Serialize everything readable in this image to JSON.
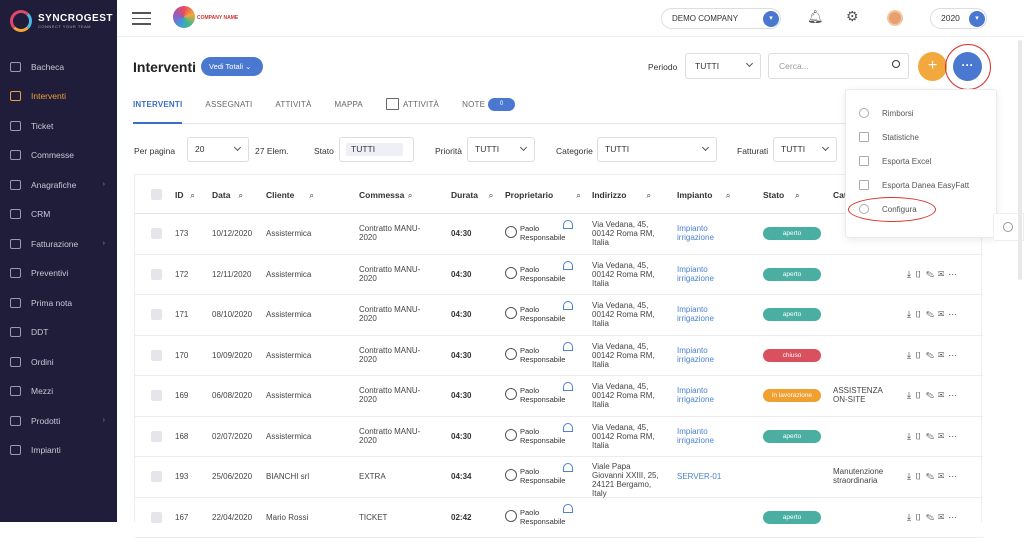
{
  "app": {
    "name": "SYNCROGEST",
    "tagline": "CONNECT YOUR TEAM"
  },
  "sidebar": {
    "items": [
      {
        "label": "Bacheca",
        "icon": "speedometer-icon",
        "active": false,
        "chevron": false
      },
      {
        "label": "Interventi",
        "icon": "tools-icon",
        "active": true,
        "chevron": false
      },
      {
        "label": "Ticket",
        "icon": "ticket-icon",
        "active": false,
        "chevron": false
      },
      {
        "label": "Commesse",
        "icon": "folder-icon",
        "active": false,
        "chevron": false
      },
      {
        "label": "Anagrafiche",
        "icon": "contacts-icon",
        "active": false,
        "chevron": true
      },
      {
        "label": "CRM",
        "icon": "handshake-icon",
        "active": false,
        "chevron": false
      },
      {
        "label": "Fatturazione",
        "icon": "invoice-icon",
        "active": false,
        "chevron": true
      },
      {
        "label": "Preventivi",
        "icon": "quote-icon",
        "active": false,
        "chevron": false
      },
      {
        "label": "Prima nota",
        "icon": "notebook-icon",
        "active": false,
        "chevron": false
      },
      {
        "label": "DDT",
        "icon": "document-icon",
        "active": false,
        "chevron": false
      },
      {
        "label": "Ordini",
        "icon": "cart-icon",
        "active": false,
        "chevron": false
      },
      {
        "label": "Mezzi",
        "icon": "truck-icon",
        "active": false,
        "chevron": false
      },
      {
        "label": "Prodotti",
        "icon": "box-icon",
        "active": false,
        "chevron": true
      },
      {
        "label": "Impianti",
        "icon": "flag-icon",
        "active": false,
        "chevron": false
      }
    ]
  },
  "topbar": {
    "company_logo_text": "COMPANY NAME",
    "company_select": "DEMO COMPANY",
    "year_select": "2020"
  },
  "header": {
    "title": "Interventi",
    "vedi_totali": "Vedi Totali",
    "periodo_label": "Periodo",
    "periodo_value": "TUTTI",
    "search_placeholder": "Cerca...",
    "add_symbol": "+",
    "more_symbol": "···"
  },
  "tabs": [
    {
      "label": "INTERVENTI",
      "active": true
    },
    {
      "label": "ASSEGNATI",
      "active": false
    },
    {
      "label": "ATTIVITÀ",
      "active": false
    },
    {
      "label": "MAPPA",
      "active": false
    },
    {
      "label": "ATTIVITÀ",
      "active": false,
      "calendar": true
    },
    {
      "label": "NOTE",
      "active": false,
      "count": "0"
    }
  ],
  "filters": {
    "per_pagina_label": "Per pagina",
    "per_pagina_value": "20",
    "elem_count": "27 Elem.",
    "stato_label": "Stato",
    "stato_value": "TUTTI",
    "priorita_label": "Priorità",
    "priorita_value": "TUTTI",
    "categorie_label": "Categorie",
    "categorie_value": "TUTTI",
    "fatturati_label": "Fatturati",
    "fatturati_value": "TUTTI"
  },
  "table": {
    "columns": [
      "ID",
      "Data",
      "Cliente",
      "Commessa",
      "Durata",
      "Proprietario",
      "Indirizzo",
      "Impianto",
      "Stato",
      "Cat"
    ],
    "rows": [
      {
        "id": "173",
        "data": "10/12/2020",
        "cliente": "Assistermica",
        "commessa": "Contratto MANU-2020",
        "durata": "04:30",
        "proprietario": "Paolo Responsabile",
        "indirizzo": "Via Vedana, 45, 00142 Roma RM, Italia",
        "impianto": "Impianto irrigazione",
        "stato": "aperto",
        "stato_color": "#4aaea0",
        "categoria": ""
      },
      {
        "id": "172",
        "data": "12/11/2020",
        "cliente": "Assistermica",
        "commessa": "Contratto MANU-2020",
        "durata": "04:30",
        "proprietario": "Paolo Responsabile",
        "indirizzo": "Via Vedana, 45, 00142 Roma RM, Italia",
        "impianto": "Impianto irrigazione",
        "stato": "aperto",
        "stato_color": "#4aaea0",
        "categoria": ""
      },
      {
        "id": "171",
        "data": "08/10/2020",
        "cliente": "Assistermica",
        "commessa": "Contratto MANU-2020",
        "durata": "04:30",
        "proprietario": "Paolo Responsabile",
        "indirizzo": "Via Vedana, 45, 00142 Roma RM, Italia",
        "impianto": "Impianto irrigazione",
        "stato": "aperto",
        "stato_color": "#4aaea0",
        "categoria": ""
      },
      {
        "id": "170",
        "data": "10/09/2020",
        "cliente": "Assistermica",
        "commessa": "Contratto MANU-2020",
        "durata": "04:30",
        "proprietario": "Paolo Responsabile",
        "indirizzo": "Via Vedana, 45, 00142 Roma RM, Italia",
        "impianto": "Impianto irrigazione",
        "stato": "chiuso",
        "stato_color": "#d9505e",
        "categoria": ""
      },
      {
        "id": "169",
        "data": "06/08/2020",
        "cliente": "Assistermica",
        "commessa": "Contratto MANU-2020",
        "durata": "04:30",
        "proprietario": "Paolo Responsabile",
        "indirizzo": "Via Vedana, 45, 00142 Roma RM, Italia",
        "impianto": "Impianto irrigazione",
        "stato": "in lavorazione",
        "stato_color": "#f0a030",
        "categoria": "ASSISTENZA ON-SITE"
      },
      {
        "id": "168",
        "data": "02/07/2020",
        "cliente": "Assistermica",
        "commessa": "Contratto MANU-2020",
        "durata": "04:30",
        "proprietario": "Paolo Responsabile",
        "indirizzo": "Via Vedana, 45, 00142 Roma RM, Italia",
        "impianto": "Impianto irrigazione",
        "stato": "aperto",
        "stato_color": "#4aaea0",
        "categoria": ""
      },
      {
        "id": "193",
        "data": "25/06/2020",
        "cliente": "BIANCHI srl",
        "commessa": "EXTRA",
        "durata": "04:34",
        "proprietario": "Paolo Responsabile",
        "indirizzo": "Viale Papa Giovanni XXIII, 25, 24121 Bergamo, Italy",
        "impianto": "SERVER-01",
        "stato": "",
        "stato_color": "",
        "categoria": "Manutenzione straordinaria"
      },
      {
        "id": "167",
        "data": "22/04/2020",
        "cliente": "Mario Rossi",
        "commessa": "TICKET",
        "durata": "02:42",
        "proprietario": "Paolo Responsabile",
        "indirizzo": "",
        "impianto": "",
        "stato": "aperto",
        "stato_color": "#4aaea0",
        "categoria": ""
      }
    ],
    "actions": [
      "download-icon",
      "pdf-icon",
      "edit-icon",
      "mail-icon",
      "more-icon"
    ]
  },
  "menu": {
    "items": [
      {
        "label": "Rimborsi",
        "icon": "info-icon"
      },
      {
        "label": "Statistiche",
        "icon": "bar-chart-icon"
      },
      {
        "label": "Esporta Excel",
        "icon": "excel-icon"
      },
      {
        "label": "Esporta Danea EasyFatt",
        "icon": "export-icon"
      },
      {
        "label": "Configura",
        "icon": "gear-icon"
      }
    ]
  },
  "colors": {
    "sidebar_bg": "#1f1d3a",
    "accent_blue": "#4a78d0",
    "accent_orange": "#f2a83c",
    "annotation_red": "#d9352c"
  }
}
